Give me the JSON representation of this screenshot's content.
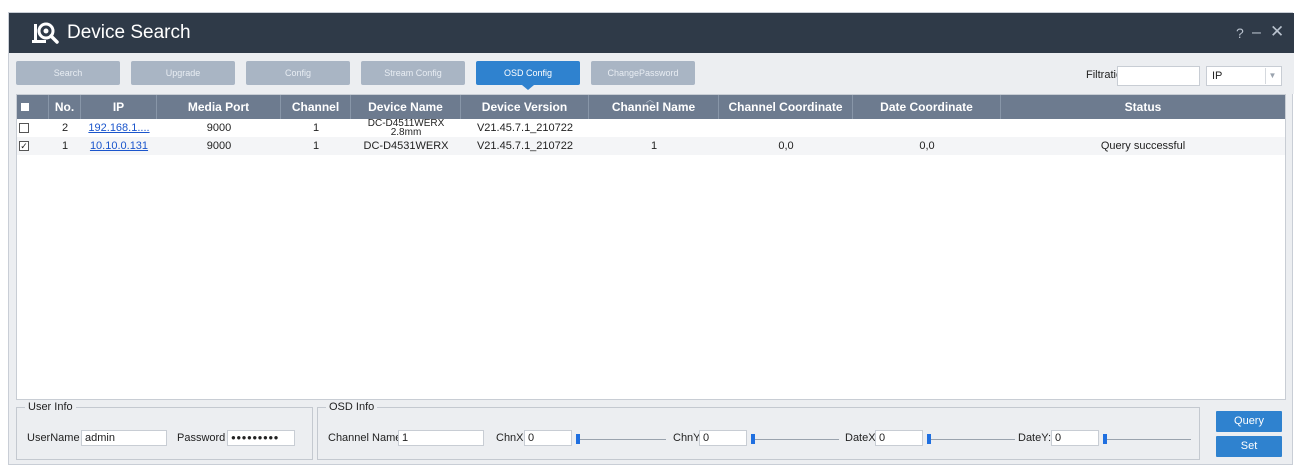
{
  "window": {
    "title": "Device Search",
    "help_glyph": "?",
    "minimize_glyph": "–",
    "close_glyph": "✕",
    "logo_icon": "device-search-logo-icon"
  },
  "toolbar": {
    "buttons": [
      "Search",
      "Upgrade",
      "Config",
      "Stream Config",
      "OSD Config",
      "ChangePassword"
    ],
    "active": "OSD Config",
    "filtration_label": "Filtration",
    "filtration_value": "",
    "filter_type": "IP"
  },
  "table": {
    "headers": [
      "No.",
      "IP",
      "Media Port",
      "Channel",
      "Device Name",
      "Device Version",
      "Channel Name",
      "Channel Coordinate",
      "Date Coordinate",
      "Status"
    ],
    "rows": [
      {
        "checked": false,
        "no": "2",
        "ip": "192.168.1....",
        "port": "9000",
        "channel": "1",
        "name_line1": "DC-D4511WERX",
        "name_line2": "2.8mm",
        "version": "V21.45.7.1_210722",
        "channel_name": "",
        "channel_coord": "",
        "date_coord": "",
        "status": ""
      },
      {
        "checked": true,
        "no": "1",
        "ip": "10.10.0.131",
        "port": "9000",
        "channel": "1",
        "name": "DC-D4531WERX",
        "version": "V21.45.7.1_210722",
        "channel_name": "1",
        "channel_coord": "0,0",
        "date_coord": "0,0",
        "status": "Query successful"
      }
    ]
  },
  "user_info": {
    "legend": "User Info",
    "username_label": "UserName",
    "username_value": "admin",
    "password_label": "Password",
    "password_value": "●●●●●●●●●"
  },
  "osd_info": {
    "legend": "OSD Info",
    "channel_name_label": "Channel Name",
    "channel_name_value": "1",
    "chnx_label": "ChnX:",
    "chnx_value": "0",
    "chny_label": "ChnY:",
    "chny_value": "0",
    "datex_label": "DateX:",
    "datex_value": "0",
    "datey_label": "DateY:",
    "datey_value": "0"
  },
  "actions": {
    "query_label": "Query",
    "set_label": "Set"
  },
  "colors": {
    "titlebar": "#2f3a48",
    "accent": "#2f82cf",
    "header": "#6d7b8f",
    "disabled_button": "#a9b5c4",
    "link": "#1a55cc"
  }
}
